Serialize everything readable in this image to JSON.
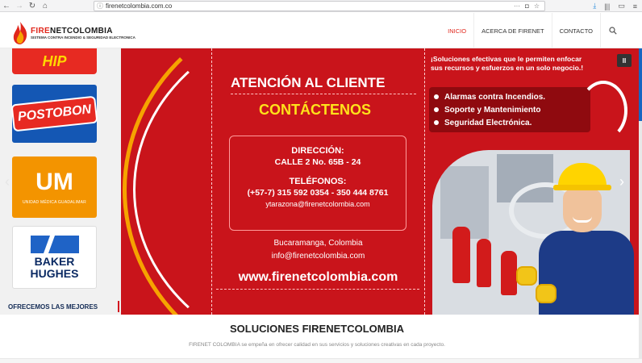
{
  "browser": {
    "url": "firenetcolombia.com.co",
    "icons": [
      "back-icon",
      "forward-icon",
      "reload-icon",
      "home-icon",
      "info-icon",
      "more-icon",
      "pocket-icon",
      "star-icon",
      "download-icon",
      "library-icon",
      "sidebar-icon",
      "menu-icon"
    ]
  },
  "header": {
    "logo_fire": "FIRE",
    "logo_rest": "NETCOLOMBIA",
    "logo_tagline": "SISTEMA CONTRA INCENDIO & SEGURIDAD ELECTRONICA",
    "nav": [
      {
        "label": "INICIO",
        "active": true
      },
      {
        "label": "ACERCA DE FIRENET",
        "active": false
      },
      {
        "label": "CONTACTO",
        "active": false
      }
    ]
  },
  "hero": {
    "brands": {
      "hipp": "HIP",
      "postobon": "POSTOBON",
      "um_big": "UM",
      "um_small": "UNIDAD MÉDICA GUADALIMAR",
      "baker1": "BAKER",
      "baker2": "HUGHES"
    },
    "brand_footer": "OFRECEMOS LAS MEJORES",
    "attention_title": "ATENCIÓN AL CLIENTE",
    "contact_title": "CONTÁCTENOS",
    "address_label": "DIRECCIÓN:",
    "address_value": "CALLE 2 No. 65B - 24",
    "phone_label": "TELÉFONOS:",
    "phone_value": "(+57-7) 315 592 0354 - 350 444 8761",
    "contact_email": "ytarazona@firenetcolombia.com",
    "city": "Bucaramanga, Colombia",
    "info_email": "info@firenetcolombia.com",
    "website": "www.firenetcolombia.com",
    "solutions_text": "¡Soluciones efectivas que le permiten enfocar sus recursos y esfuerzos en un solo negocio.!",
    "services": [
      "Alarmas contra Incendios.",
      "Soporte y Mantenimiento",
      "Seguridad Electrónica."
    ],
    "pause_label": "II",
    "prev_label": "‹",
    "next_label": "›"
  },
  "section": {
    "title": "SOLUCIONES FIRENETCOLOMBIA",
    "description": "FIRENET COLOMBIA se empeña en ofrecer calidad en sus servicios y soluciones creativas en cada proyecto."
  },
  "colors": {
    "brand_red": "#e0261b",
    "hero_red": "#c9141b",
    "accent_yellow": "#ffe21a",
    "scroll_blue": "#1766c2"
  }
}
